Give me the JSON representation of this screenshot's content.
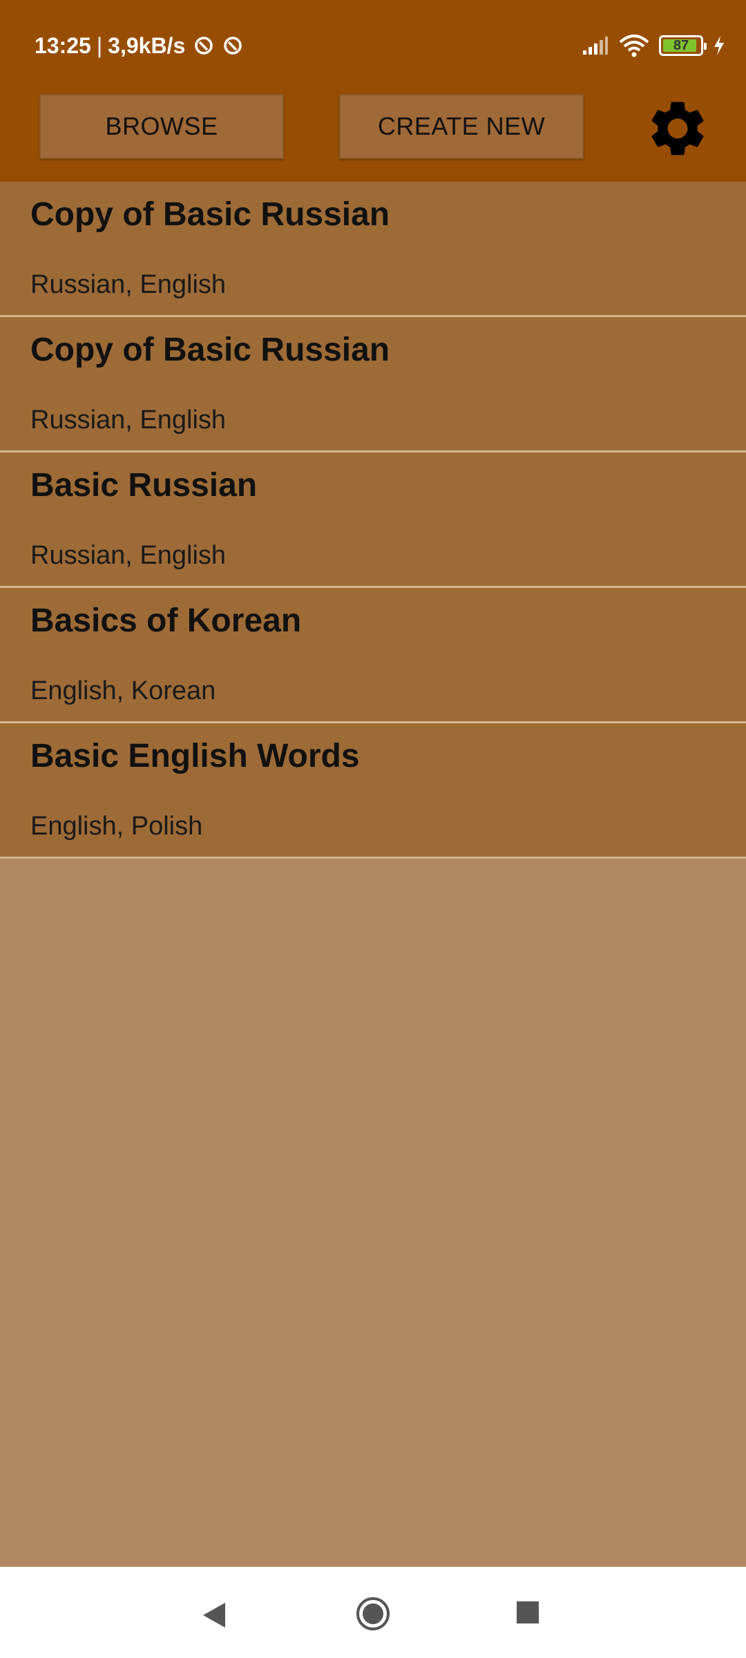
{
  "status_bar": {
    "time": "13:25",
    "separator": "|",
    "speed": "3,9kB/s",
    "battery": "87"
  },
  "toolbar": {
    "browse_label": "BROWSE",
    "create_label": "CREATE NEW"
  },
  "decks": [
    {
      "title": "Copy of Basic Russian",
      "languages": "Russian, English"
    },
    {
      "title": "Copy of Basic Russian",
      "languages": "Russian, English"
    },
    {
      "title": "Basic Russian",
      "languages": "Russian, English"
    },
    {
      "title": "Basics of Korean",
      "languages": "English, Korean"
    },
    {
      "title": "Basic English Words",
      "languages": "English, Polish"
    }
  ],
  "colors": {
    "header": "#984e02",
    "list_item": "#9e6b37",
    "background": "#b0875e",
    "divider": "#d3b98f"
  },
  "icons": [
    "sync-icon",
    "sync-icon",
    "signal-icon",
    "wifi-icon",
    "battery-icon",
    "charging-icon",
    "gear-icon",
    "back-icon",
    "home-icon",
    "recents-icon"
  ]
}
